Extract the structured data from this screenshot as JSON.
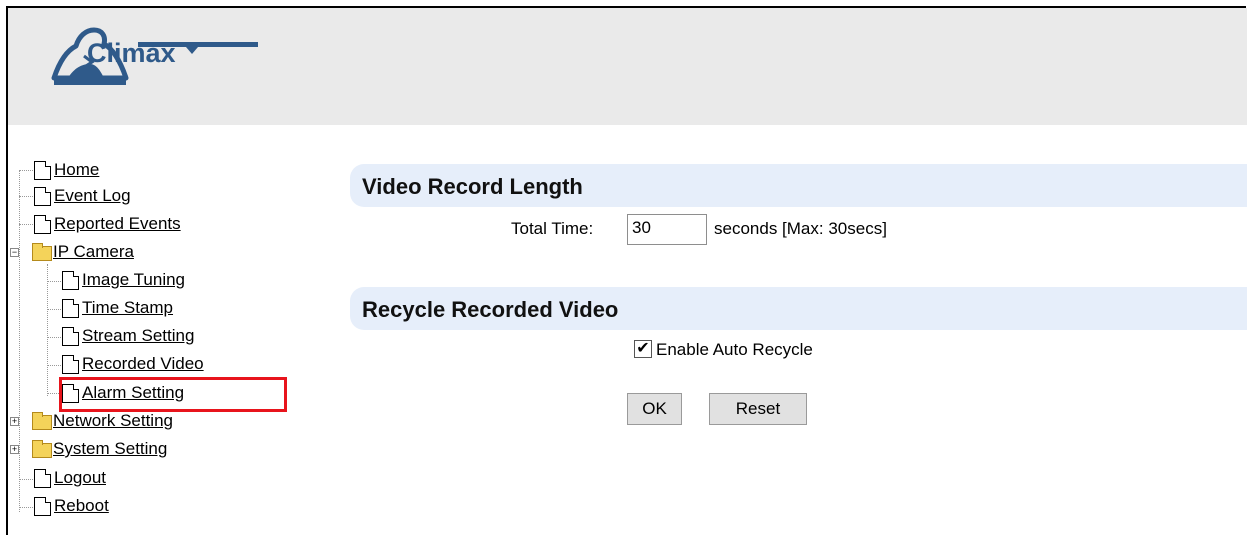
{
  "brand": {
    "name": "Climax"
  },
  "nav": {
    "home": "Home",
    "event_log": "Event Log",
    "reported_events": "Reported Events",
    "ip_camera": "IP Camera",
    "image_tuning": "Image Tuning",
    "time_stamp": "Time Stamp",
    "stream_setting": "Stream Setting",
    "recorded_video": "Recorded Video",
    "alarm_setting": "Alarm Setting",
    "network_setting": "Network Setting",
    "system_setting": "System Setting",
    "logout": "Logout",
    "reboot": "Reboot"
  },
  "video_record": {
    "title": "Video Record Length",
    "total_time_label": "Total Time:",
    "total_time_value": "30",
    "unit_label": "seconds [Max: 30secs]"
  },
  "recycle": {
    "title": "Recycle Recorded Video",
    "checkbox_label": "Enable Auto Recycle",
    "checked": true,
    "check_glyph": "✔"
  },
  "buttons": {
    "ok": "OK",
    "reset": "Reset"
  },
  "toggles": {
    "expanded": "−",
    "collapsed": "+"
  },
  "colors": {
    "highlight": "#e8141c",
    "section_bg": "#e6eefa",
    "brand": "#2f5a8a",
    "header_bg": "#eaeaea"
  }
}
